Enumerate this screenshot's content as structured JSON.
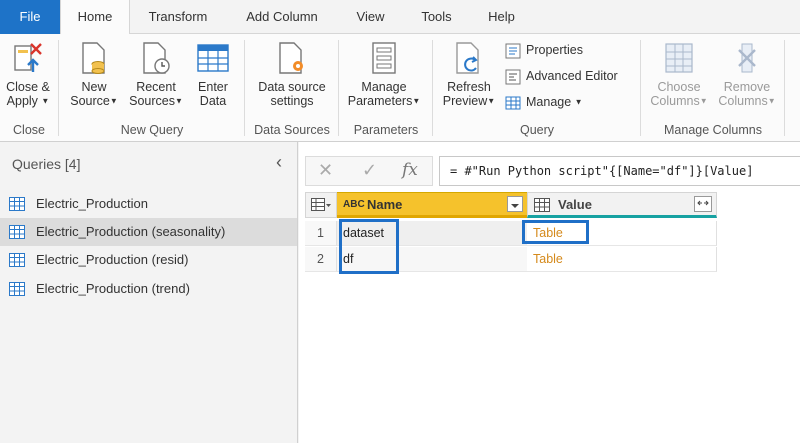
{
  "tabs": [
    "File",
    "Home",
    "Transform",
    "Add Column",
    "View",
    "Tools",
    "Help"
  ],
  "ribbon": {
    "close_apply": [
      "Close &",
      "Apply"
    ],
    "new_source": [
      "New",
      "Source"
    ],
    "recent_sources": [
      "Recent",
      "Sources"
    ],
    "enter_data": [
      "Enter",
      "Data"
    ],
    "data_source_settings": [
      "Data source",
      "settings"
    ],
    "manage_parameters": [
      "Manage",
      "Parameters"
    ],
    "refresh_preview": [
      "Refresh",
      "Preview"
    ],
    "properties": "Properties",
    "advanced_editor": "Advanced Editor",
    "manage": "Manage",
    "choose_columns": [
      "Choose",
      "Columns"
    ],
    "remove_columns": [
      "Remove",
      "Columns"
    ],
    "groups": [
      "Close",
      "New Query",
      "Data Sources",
      "Parameters",
      "Query",
      "Manage Columns"
    ]
  },
  "queries": {
    "title": "Queries [4]",
    "items": [
      "Electric_Production",
      "Electric_Production (seasonality)",
      "Electric_Production (resid)",
      "Electric_Production (trend)"
    ]
  },
  "formula": {
    "text": "= #\"Run Python script\"{[Name=\"df\"]}[Value]"
  },
  "table": {
    "type_label": "ABC",
    "columns": [
      "Name",
      "Value"
    ],
    "rows": [
      {
        "num": "1",
        "name": "dataset",
        "value": "Table"
      },
      {
        "num": "2",
        "name": "df",
        "value": "Table"
      }
    ]
  },
  "colors": {
    "file_tab": "#1e73c8",
    "name_header": "#f5c22c",
    "table_link": "#d58a1c",
    "highlight": "#1f6fc7"
  }
}
